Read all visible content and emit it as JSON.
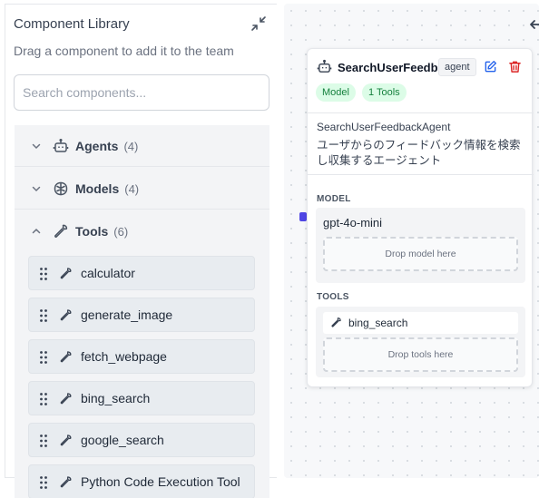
{
  "library": {
    "title": "Component Library",
    "subtitle": "Drag a component to add it to the team",
    "search_placeholder": "Search components..."
  },
  "categories": [
    {
      "name": "Agents",
      "count": "(4)",
      "expanded": false,
      "icon": "bot-icon"
    },
    {
      "name": "Models",
      "count": "(4)",
      "expanded": false,
      "icon": "brain-icon"
    },
    {
      "name": "Tools",
      "count": "(6)",
      "expanded": true,
      "icon": "wrench-icon"
    }
  ],
  "tools": [
    {
      "label": "calculator"
    },
    {
      "label": "generate_image"
    },
    {
      "label": "fetch_webpage"
    },
    {
      "label": "bing_search"
    },
    {
      "label": "google_search"
    },
    {
      "label": "Python Code Execution Tool"
    }
  ],
  "node": {
    "title": "SearchUserFeedb...",
    "type_badge": "agent",
    "pills": {
      "model": "Model",
      "tools": "1 Tools"
    },
    "name": "SearchUserFeedbackAgent",
    "description": "ユーザからのフィードバック情報を検索し収集するエージェント",
    "model_section": {
      "label": "MODEL",
      "model_name": "gpt-4o-mini",
      "drop_text": "Drop model here"
    },
    "tools_section": {
      "label": "TOOLS",
      "tool_name": "bing_search",
      "drop_text": "Drop tools here"
    }
  },
  "colors": {
    "accent": "#4f46e5",
    "edit": "#2563eb",
    "delete": "#dc2626",
    "pill_bg": "#dcfce7",
    "pill_text": "#15803d"
  }
}
